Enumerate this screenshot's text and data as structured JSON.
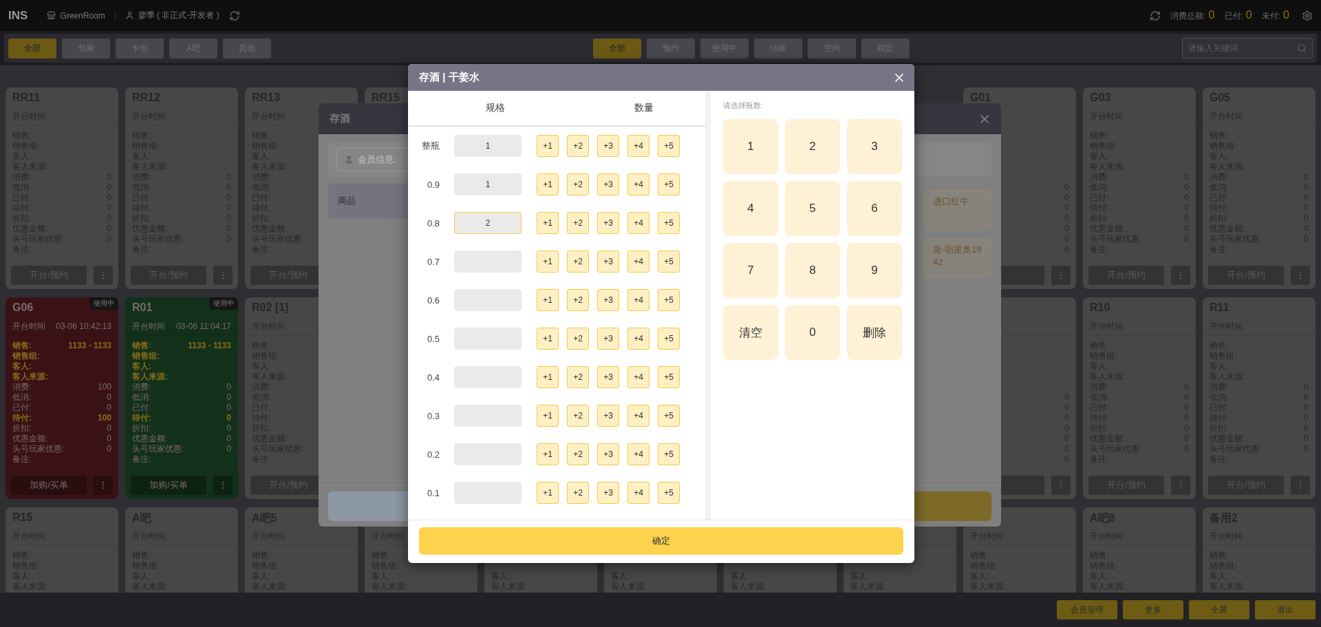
{
  "topbar": {
    "logo": "INS",
    "store": "GreenRoom",
    "user": "廖季 ( 非正式-开发者 )",
    "stats": [
      {
        "label": "消费总额:",
        "value": "0"
      },
      {
        "label": "已付:",
        "value": "0"
      },
      {
        "label": "未付:",
        "value": "0"
      }
    ]
  },
  "filters": {
    "types": [
      {
        "label": "全部",
        "selected": true
      },
      {
        "label": "包厢",
        "selected": false
      },
      {
        "label": "卡包",
        "selected": false
      },
      {
        "label": "A吧",
        "selected": false
      },
      {
        "label": "其他",
        "selected": false
      }
    ],
    "statuses": [
      {
        "label": "全部",
        "selected": true
      },
      {
        "label": "预约",
        "selected": false
      },
      {
        "label": "使用中",
        "selected": false
      },
      {
        "label": "结账",
        "selected": false
      },
      {
        "label": "空闲",
        "selected": false
      },
      {
        "label": "锁定",
        "selected": false
      }
    ],
    "search": {
      "placeholder": "请输入关键词"
    }
  },
  "room_rows": [
    {
      "left": [
        {
          "name": "RR11",
          "kind": "idle",
          "color": "#474747",
          "open_label": "开台时间",
          "fields": [
            {
              "label": "销售:",
              "highlight": false
            },
            {
              "label": "销售组:",
              "highlight": false
            },
            {
              "label": "客人:",
              "highlight": false
            },
            {
              "label": "客人来源:",
              "highlight": false
            },
            {
              "label": "消费:",
              "value": "0",
              "highlight": false
            },
            {
              "label": "低消:",
              "value": "0",
              "highlight": false
            },
            {
              "label": "已付:",
              "value": "0",
              "highlight": false
            },
            {
              "label": "待付:",
              "value": "0",
              "highlight": false
            },
            {
              "label": "折扣:",
              "value": "0",
              "highlight": false
            },
            {
              "label": "优惠金额:",
              "value": "0",
              "highlight": false
            },
            {
              "label": "头号玩家优惠:",
              "value": "0",
              "highlight": false
            },
            {
              "label": "备注:",
              "highlight": false
            }
          ],
          "action_button": true,
          "action_label": "开台/预约",
          "menu": true
        },
        {
          "name": "RR12",
          "kind": "idle",
          "color": "#474747",
          "open_label": "开台时间",
          "fields": [
            {
              "label": "销售:",
              "highlight": false
            },
            {
              "label": "销售组:",
              "highlight": false
            },
            {
              "label": "客人:",
              "highlight": false
            },
            {
              "label": "客人来源:",
              "highlight": false
            },
            {
              "label": "消费:",
              "value": "0",
              "highlight": false
            },
            {
              "label": "低消:",
              "value": "0",
              "highlight": false
            },
            {
              "label": "已付:",
              "value": "0",
              "highlight": false
            },
            {
              "label": "待付:",
              "value": "0",
              "highlight": false
            },
            {
              "label": "折扣:",
              "value": "0",
              "highlight": false
            },
            {
              "label": "优惠金额:",
              "value": "0",
              "highlight": false
            },
            {
              "label": "头号玩家优惠:",
              "value": "0",
              "highlight": false
            },
            {
              "label": "备注:",
              "highlight": false
            }
          ],
          "action_button": true,
          "action_label": "开台/预约",
          "menu": true
        },
        {
          "name": "RR13",
          "kind": "idle",
          "color": "#474747",
          "open_label": "开台时间",
          "fields": [
            {
              "label": "销售:",
              "highlight": false
            },
            {
              "label": "销售组:",
              "highlight": false
            },
            {
              "label": "客人:",
              "highlight": false
            },
            {
              "label": "客人来源:",
              "highlight": false
            },
            {
              "label": "消费:",
              "highlight": false
            },
            {
              "label": "低消:",
              "highlight": false
            },
            {
              "label": "已付:",
              "highlight": false
            },
            {
              "label": "待付:",
              "highlight": false
            },
            {
              "label": "折扣:",
              "highlight": false
            },
            {
              "label": "优惠金额:",
              "highlight": false
            },
            {
              "label": "头号玩家优惠:",
              "highlight": false
            },
            {
              "label": "备注:",
              "highlight": false
            }
          ],
          "action_button": true,
          "action_label": "开台/预约"
        },
        {
          "name": "RR15",
          "kind": "idle",
          "color": "#474747"
        }
      ],
      "right": [
        {
          "name": "G01",
          "kind": "idle",
          "color": "#474747",
          "fields": [
            {
              "value": "0",
              "highlight": false
            },
            {
              "value": "0",
              "highlight": false
            },
            {
              "value": "0",
              "highlight": false
            },
            {
              "value": "0",
              "highlight": false
            },
            {
              "value": "0",
              "highlight": false
            },
            {
              "value": "0",
              "highlight": false
            },
            {
              "value": "0",
              "highlight": false
            }
          ],
          "action_button": true,
          "menu": true
        },
        {
          "name": "G03",
          "kind": "idle",
          "color": "#474747",
          "open_label": "开台时间",
          "fields": [
            {
              "label": "销售:",
              "highlight": false
            },
            {
              "label": "销售组:",
              "highlight": false
            },
            {
              "label": "客人:",
              "highlight": false
            },
            {
              "label": "客人来源:",
              "highlight": false
            },
            {
              "label": "消费:",
              "value": "0",
              "highlight": false
            },
            {
              "label": "低消:",
              "value": "0",
              "highlight": false
            },
            {
              "label": "已付:",
              "value": "0",
              "highlight": false
            },
            {
              "label": "待付:",
              "value": "0",
              "highlight": false
            },
            {
              "label": "折扣:",
              "value": "0",
              "highlight": false
            },
            {
              "label": "优惠金额:",
              "value": "0",
              "highlight": false
            },
            {
              "label": "头号玩家优惠:",
              "value": "0",
              "highlight": false
            },
            {
              "label": "备注:",
              "highlight": false
            }
          ],
          "action_button": true,
          "action_label": "开台/预约",
          "menu": true
        },
        {
          "name": "G05",
          "kind": "idle",
          "color": "#474747",
          "open_label": "开台时间",
          "fields": [
            {
              "label": "销售:",
              "highlight": false
            },
            {
              "label": "销售组:",
              "highlight": false
            },
            {
              "label": "客人:",
              "highlight": false
            },
            {
              "label": "客人来源:",
              "highlight": false
            },
            {
              "label": "消费:",
              "value": "0",
              "highlight": false
            },
            {
              "label": "低消:",
              "value": "0",
              "highlight": false
            },
            {
              "label": "已付:",
              "value": "0",
              "highlight": false
            },
            {
              "label": "待付:",
              "value": "0",
              "highlight": false
            },
            {
              "label": "折扣:",
              "value": "0",
              "highlight": false
            },
            {
              "label": "优惠金额:",
              "value": "0",
              "highlight": false
            },
            {
              "label": "头号玩家优惠:",
              "value": "0",
              "highlight": false
            },
            {
              "label": "备注:",
              "highlight": false
            }
          ],
          "action_button": true,
          "action_label": "开台/预约",
          "menu": true
        }
      ]
    },
    {
      "left": [
        {
          "name": "G06",
          "kind": "busy",
          "color": "#3a1216",
          "badge": "使用中",
          "open_label": "开台时间",
          "open_time": "03-06 10:42:13",
          "fields": [
            {
              "label": "销售:",
              "value": "1133 - 1133",
              "highlight": true
            },
            {
              "label": "销售组:",
              "highlight": true
            },
            {
              "label": "客人:",
              "highlight": true
            },
            {
              "label": "客人来源:",
              "highlight": true
            },
            {
              "label": "消费:",
              "value": "100",
              "highlight": false
            },
            {
              "label": "低消:",
              "value": "0",
              "highlight": false
            },
            {
              "label": "已付:",
              "value": "0",
              "highlight": false
            },
            {
              "label": "待付:",
              "value": "100",
              "highlight": true
            },
            {
              "label": "折扣:",
              "value": "0",
              "highlight": false
            },
            {
              "label": "优惠金额:",
              "value": "0",
              "highlight": false
            },
            {
              "label": "头号玩家优惠:",
              "value": "0",
              "highlight": false
            },
            {
              "label": "备注:",
              "highlight": false
            }
          ],
          "action_button": true,
          "action_label": "加购/买单",
          "menu": true
        },
        {
          "name": "R01",
          "kind": "busy",
          "color": "#13301b",
          "badge": "使用中",
          "open_label": "开台时间",
          "open_time": "03-06 11:04:17",
          "fields": [
            {
              "label": "销售:",
              "value": "1133 - 1133",
              "highlight": true
            },
            {
              "label": "销售组:",
              "highlight": true
            },
            {
              "label": "客人:",
              "highlight": true
            },
            {
              "label": "客人来源:",
              "highlight": true
            },
            {
              "label": "消费:",
              "value": "0",
              "highlight": false
            },
            {
              "label": "低消:",
              "value": "0",
              "highlight": false
            },
            {
              "label": "已付:",
              "value": "0",
              "highlight": false
            },
            {
              "label": "待付:",
              "value": "0",
              "highlight": true
            },
            {
              "label": "折扣:",
              "value": "0",
              "highlight": false
            },
            {
              "label": "优惠金额:",
              "value": "0",
              "highlight": false
            },
            {
              "label": "头号玩家优惠:",
              "value": "0",
              "highlight": false
            },
            {
              "label": "备注:",
              "highlight": false
            }
          ],
          "action_button": true,
          "action_label": "加购/买单",
          "menu": true
        },
        {
          "name": "R02 [1]",
          "kind": "idle",
          "color": "#474747",
          "open_label": "开台时间",
          "fields": [
            {
              "label": "销售:",
              "highlight": false
            },
            {
              "label": "销售组:",
              "highlight": false
            },
            {
              "label": "客人:",
              "highlight": false
            },
            {
              "label": "客人来源:",
              "highlight": false
            },
            {
              "label": "消费:",
              "highlight": false
            },
            {
              "label": "低消:",
              "highlight": false
            },
            {
              "label": "已付:",
              "highlight": false
            },
            {
              "label": "待付:",
              "highlight": false
            },
            {
              "label": "折扣:",
              "highlight": false
            },
            {
              "label": "优惠金额:",
              "highlight": false
            },
            {
              "label": "头号玩家优惠:",
              "highlight": false
            },
            {
              "label": "备注:",
              "highlight": false
            }
          ],
          "action_button": true,
          "action_label": "开台/预约"
        }
      ],
      "right": [
        {
          "kind": "idle",
          "color": "#474747",
          "fields": [
            {
              "value": "0",
              "highlight": false
            },
            {
              "value": "0",
              "highlight": false
            },
            {
              "value": "0",
              "highlight": false
            },
            {
              "value": "0",
              "highlight": false
            },
            {
              "value": "0",
              "highlight": false
            },
            {
              "value": "0",
              "highlight": false
            },
            {
              "value": "0",
              "highlight": false
            }
          ],
          "action_button": true,
          "menu": true
        },
        {
          "name": "R10",
          "kind": "idle",
          "color": "#474747",
          "open_label": "开台时间",
          "fields": [
            {
              "label": "销售:",
              "highlight": false
            },
            {
              "label": "销售组:",
              "highlight": false
            },
            {
              "label": "客人:",
              "highlight": false
            },
            {
              "label": "客人来源:",
              "highlight": false
            },
            {
              "label": "消费:",
              "value": "0",
              "highlight": false
            },
            {
              "label": "低消:",
              "value": "0",
              "highlight": false
            },
            {
              "label": "已付:",
              "value": "0",
              "highlight": false
            },
            {
              "label": "待付:",
              "value": "0",
              "highlight": false
            },
            {
              "label": "折扣:",
              "value": "0",
              "highlight": false
            },
            {
              "label": "优惠金额:",
              "value": "0",
              "highlight": false
            },
            {
              "label": "头号玩家优惠:",
              "value": "0",
              "highlight": false
            },
            {
              "label": "备注:",
              "highlight": false
            }
          ],
          "action_button": true,
          "action_label": "开台/预约",
          "menu": true
        },
        {
          "name": "R11",
          "kind": "idle",
          "color": "#474747",
          "open_label": "开台时间",
          "fields": [
            {
              "label": "销售:",
              "highlight": false
            },
            {
              "label": "销售组:",
              "highlight": false
            },
            {
              "label": "客人:",
              "highlight": false
            },
            {
              "label": "客人来源:",
              "highlight": false
            },
            {
              "label": "消费:",
              "value": "0",
              "highlight": false
            },
            {
              "label": "低消:",
              "value": "0",
              "highlight": false
            },
            {
              "label": "已付:",
              "value": "0",
              "highlight": false
            },
            {
              "label": "待付:",
              "value": "0",
              "highlight": false
            },
            {
              "label": "折扣:",
              "value": "0",
              "highlight": false
            },
            {
              "label": "优惠金额:",
              "value": "0",
              "highlight": false
            },
            {
              "label": "头号玩家优惠:",
              "value": "0",
              "highlight": false
            },
            {
              "label": "备注:",
              "highlight": false
            }
          ],
          "action_button": true,
          "action_label": "开台/预约",
          "menu": true
        }
      ]
    },
    {
      "left": [
        {
          "name": "R15",
          "kind": "idle",
          "color": "#474747",
          "open_label": "开台时间",
          "fields": [
            {
              "label": "销售:",
              "highlight": false
            },
            {
              "label": "销售组:",
              "highlight": false
            },
            {
              "label": "客人:",
              "highlight": false
            },
            {
              "label": "客人来源:",
              "highlight": false
            }
          ]
        },
        {
          "name": "A吧",
          "kind": "idle",
          "color": "#474747",
          "open_label": "开台时间",
          "fields": [
            {
              "label": "销售:",
              "highlight": false
            },
            {
              "label": "销售组:",
              "highlight": false
            },
            {
              "label": "客人:",
              "highlight": false
            },
            {
              "label": "客人来源:",
              "highlight": false
            }
          ]
        },
        {
          "name": "A吧5",
          "kind": "idle",
          "color": "#474747",
          "open_label": "开台时间",
          "fields": [
            {
              "label": "销售:",
              "highlight": false
            },
            {
              "label": "销售组:",
              "highlight": false
            },
            {
              "label": "客人:",
              "highlight": false
            },
            {
              "label": "客人来源:",
              "highlight": false
            }
          ]
        },
        {
          "kind": "idle",
          "color": "#474747",
          "open_label": "开台时间",
          "fields": [
            {
              "label": "销售:",
              "highlight": false
            },
            {
              "label": "销售组:",
              "highlight": false
            },
            {
              "label": "客人:",
              "highlight": false
            },
            {
              "label": "客人来源:",
              "highlight": false
            }
          ]
        },
        {
          "kind": "idle",
          "color": "#474747",
          "fields": [
            {
              "label": "客人:",
              "highlight": false
            },
            {
              "label": "客人来源:",
              "highlight": false
            }
          ]
        },
        {
          "kind": "idle",
          "color": "#474747",
          "fields": [
            {
              "label": "客人:",
              "highlight": false
            },
            {
              "label": "客人来源:",
              "highlight": false
            }
          ]
        },
        {
          "kind": "idle",
          "color": "#474747",
          "fields": [
            {
              "label": "客人:",
              "highlight": false
            },
            {
              "label": "客人来源:",
              "highlight": false
            }
          ]
        },
        {
          "kind": "idle",
          "color": "#474747",
          "fields": [
            {
              "label": "客人:",
              "highlight": false
            },
            {
              "label": "客人来源:",
              "highlight": false
            }
          ]
        },
        {
          "kind": "idle",
          "color": "#474747",
          "open_label": "开台时间",
          "fields": [
            {
              "label": "销售:",
              "highlight": false
            },
            {
              "label": "销售组:",
              "highlight": false
            },
            {
              "label": "客人:",
              "highlight": false
            },
            {
              "label": "客人来源:",
              "highlight": false
            }
          ]
        },
        {
          "name": "A吧8",
          "kind": "idle",
          "color": "#474747",
          "open_label": "开台时间",
          "fields": [
            {
              "label": "销售:",
              "highlight": false
            },
            {
              "label": "销售组:",
              "highlight": false
            },
            {
              "label": "客人:",
              "highlight": false
            },
            {
              "label": "客人来源:",
              "highlight": false
            }
          ]
        },
        {
          "name": "备用2",
          "kind": "idle",
          "color": "#474747",
          "open_label": "开台时间",
          "fields": [
            {
              "label": "销售:",
              "highlight": false
            },
            {
              "label": "销售组:",
              "highlight": false
            },
            {
              "label": "客人:",
              "highlight": false
            },
            {
              "label": "客人来源:",
              "highlight": false
            }
          ]
        }
      ]
    }
  ],
  "store_dialog": {
    "title": "存酒",
    "member_placeholder": "会员信息:",
    "tabs": [
      {
        "label": "商品",
        "selected": true
      }
    ],
    "products": [
      "进口红牛",
      "唐-胡里奥1942"
    ]
  },
  "bottle_dialog": {
    "title": "存酒 | 干姜水",
    "headers": [
      "规格",
      "数量"
    ],
    "rows": [
      {
        "spec": "整瓶",
        "value": "1",
        "selected": false,
        "steps": [
          "+1",
          "+2",
          "+3",
          "+4",
          "+5"
        ]
      },
      {
        "spec": "0.9",
        "value": "1",
        "selected": false,
        "steps": [
          "+1",
          "+2",
          "+3",
          "+4",
          "+5"
        ]
      },
      {
        "spec": "0.8",
        "value": "2",
        "selected": true,
        "steps": [
          "+1",
          "+2",
          "+3",
          "+4",
          "+5"
        ]
      },
      {
        "spec": "0.7",
        "selected": false,
        "steps": [
          "+1",
          "+2",
          "+3",
          "+4",
          "+5"
        ]
      },
      {
        "spec": "0.6",
        "selected": false,
        "steps": [
          "+1",
          "+2",
          "+3",
          "+4",
          "+5"
        ]
      },
      {
        "spec": "0.5",
        "selected": false,
        "steps": [
          "+1",
          "+2",
          "+3",
          "+4",
          "+5"
        ]
      },
      {
        "spec": "0.4",
        "selected": false,
        "steps": [
          "+1",
          "+2",
          "+3",
          "+4",
          "+5"
        ]
      },
      {
        "spec": "0.3",
        "selected": false,
        "steps": [
          "+1",
          "+2",
          "+3",
          "+4",
          "+5"
        ]
      },
      {
        "spec": "0.2",
        "selected": false,
        "steps": [
          "+1",
          "+2",
          "+3",
          "+4",
          "+5"
        ]
      },
      {
        "spec": "0.1",
        "selected": false,
        "steps": [
          "+1",
          "+2",
          "+3",
          "+4",
          "+5"
        ]
      }
    ],
    "keypad_label": "请选择瓶数:",
    "keys": [
      "1",
      "2",
      "3",
      "4",
      "5",
      "6",
      "7",
      "8",
      "9",
      "清空",
      "0",
      "删除"
    ],
    "confirm": "确定"
  },
  "bottom_bar": {
    "buttons": [
      "会员管理",
      "更多",
      "全屏",
      "退出"
    ]
  }
}
